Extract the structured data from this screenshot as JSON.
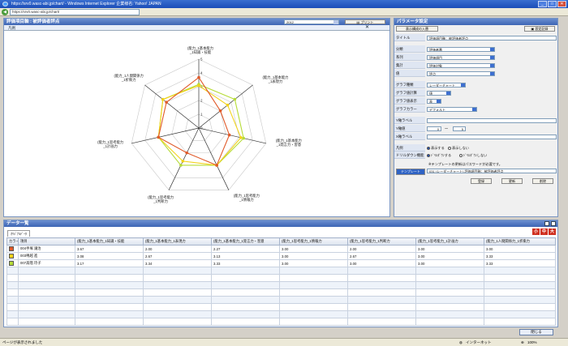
{
  "browser": {
    "title": "https://srv0.wasc-abi.jp/chart/ - Windows Internet Explorer 企業様名: Yahoo! JAPAN",
    "url": "https://srv0.wasc-abi.jp/chart/",
    "status_left": "ページが表示されました",
    "status_zone": "インターネット",
    "zoom": "100%"
  },
  "chart_panel": {
    "title": "評価項目軸 : 被評価者評点",
    "year_value": "2012",
    "print_label": "プリント",
    "legend_label": "凡例",
    "close_glyph": "✕"
  },
  "chart_data": {
    "type": "radar",
    "axes": [
      "(能力_1基本能力_1知識・技能",
      "(能力_1基本能力_1表現力",
      "(能力_1基本能力_1発言力・習意",
      "(能力_1思考能力_1情報力",
      "(能力_1思考能力_1判断力",
      "(能力_1思考能力_1計画力",
      "(能力_1人間関係力_1折衝力"
    ],
    "rlim": [
      0,
      5
    ],
    "ticks": [
      "0",
      "1",
      "2",
      "3",
      "4",
      "5"
    ],
    "series": [
      {
        "color": "#e05a2a",
        "values": [
          3.67,
          2.0,
          2.27,
          3.0,
          2.0,
          3.0,
          3.0
        ]
      },
      {
        "color": "#f2d21a",
        "values": [
          3.08,
          2.67,
          3.13,
          3.0,
          2.67,
          3.0,
          3.33
        ]
      },
      {
        "color": "#b6dc38",
        "values": [
          3.17,
          3.34,
          3.33,
          3.0,
          3.0,
          3.0,
          3.33
        ]
      }
    ]
  },
  "params": {
    "title": "パラメータ設定",
    "tool_left": "表示構成の入替",
    "tool_right": "設定記録",
    "rows": [
      {
        "label": "タイトル",
        "value": "評価項目軸：被評価者評点"
      },
      {
        "label": "分類",
        "value": "評価者番"
      },
      {
        "label": "系列",
        "value": "評価項目"
      },
      {
        "label": "集計",
        "value": "評価対象"
      },
      {
        "label": "値",
        "value": "評点"
      }
    ],
    "graph_type_label": "グラフ種類",
    "graph_type_value": "レーダーチャート",
    "graph_sum_label": "グラフ値計算",
    "graph_sum_value": "値",
    "graph_disp_label": "グラフ値表示",
    "graph_disp_value": "表",
    "graph_color_label": "グラフカラー",
    "graph_color_value": "デフォルト",
    "y_axis_label": "Y軸ラベル",
    "y_range_label": "Y軸値",
    "y_min": "0",
    "y_sep": "〜",
    "y_max": "5",
    "x_axis_label": "X軸ラベル",
    "legend_label": "凡例",
    "legend_show": "表示する",
    "legend_hide": "表示しない",
    "drill_label": "ドリルダウン機能",
    "drill_on": "ﾄﾞﾘﾙﾀﾞｳﾝする",
    "drill_off": "ﾄﾞﾘﾙﾀﾞｳﾝしない",
    "template_note": "※テンプレートの更新はパスワードが必要です。",
    "template_button": "テンプレート",
    "template_value": "031 (レーダーチャート) 評価項目軸：被評価者評点",
    "register": "登録",
    "update": "更新",
    "delete": "削除"
  },
  "data_panel": {
    "title": "データ一覧",
    "tab": "ｵﾘｼﾞﾅﾙﾃﾞｰﾀ",
    "size_small": "小",
    "size_mid": "中",
    "size_large": "大",
    "columns": [
      "カラー",
      "項目",
      "(能力_1基本能力_1知識・技能",
      "(能力_1基本能力_1表現力",
      "(能力_1基本能力_1発言力・習意",
      "(能力_1思考能力_1情報力",
      "(能力_1思考能力_1判断力",
      "(能力_1思考能力_1計画力",
      "(能力_1人間関係力_1折衝力"
    ],
    "rows": [
      {
        "color": "#e05a2a",
        "name": "004手塚 譲治",
        "values": [
          "3.67",
          "2.00",
          "2.27",
          "3.00",
          "2.00",
          "3.00",
          "3.00"
        ]
      },
      {
        "color": "#f2d21a",
        "name": "003鳴越 進",
        "values": [
          "3.08",
          "2.67",
          "3.13",
          "3.00",
          "2.67",
          "3.00",
          "3.33"
        ]
      },
      {
        "color": "#b6dc38",
        "name": "007高階 玲子",
        "values": [
          "3.17",
          "3.34",
          "3.33",
          "3.00",
          "3.00",
          "3.00",
          "3.33"
        ]
      }
    ],
    "close_label": "閉じる"
  }
}
